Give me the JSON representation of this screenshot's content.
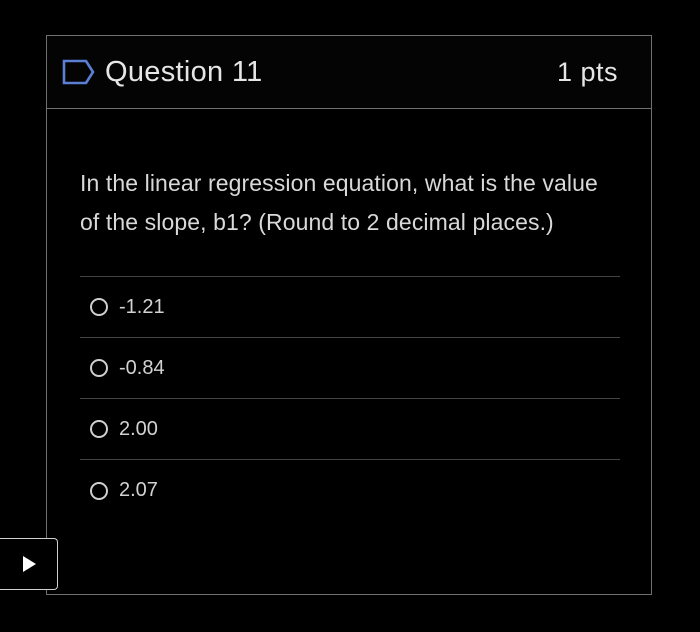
{
  "question": {
    "title": "Question 11",
    "points": "1 pts",
    "prompt": "In the linear regression equation, what is the value of the slope, b1?  (Round to 2 decimal places.)",
    "answers": [
      {
        "label": "-1.21"
      },
      {
        "label": "-0.84"
      },
      {
        "label": "2.00"
      },
      {
        "label": "2.07"
      }
    ]
  },
  "icons": {
    "flag": "flag-outline-icon",
    "play": "play-icon"
  },
  "colors": {
    "flag_blue": "#5c7fd6",
    "background": "#000000",
    "border": "#6f6f6f"
  }
}
